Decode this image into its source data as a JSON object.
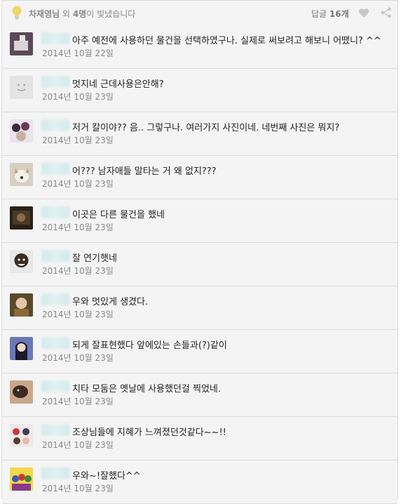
{
  "header": {
    "likes_name": "차재영님",
    "likes_mid": " 외 ",
    "likes_count": "4명",
    "likes_suffix": "이 빛냈습니다",
    "reply_label": "답글 ",
    "reply_count": "16개",
    "icons": [
      "lightbulb-icon",
      "heart-icon",
      "share-icon"
    ]
  },
  "comments": [
    {
      "text": "아주 예전에 사용하던 물건을 선택하였구나. 실제로 써보려고 해보니 어땠니? ^^",
      "date": "2014년 10월 22일",
      "avatar": "photo"
    },
    {
      "text": "멋지네 근데사용은안해?",
      "date": "2014년 10월 23일",
      "avatar": "default"
    },
    {
      "text": "저거 칼이야?? 음.. 그렇구나. 여러가지 사진이네. 네번째 사진은 뭐지?",
      "date": "2014년 10월 23일",
      "avatar": "photo"
    },
    {
      "text": "어??? 남자애들 말타는 거 왜 없지???",
      "date": "2014년 10월 23일",
      "avatar": "photo"
    },
    {
      "text": "이곳은 다른 물건을 했네",
      "date": "2014년 10월 23일",
      "avatar": "photo"
    },
    {
      "text": "잘 연기햇네",
      "date": "2014년 10월 23일",
      "avatar": "photo"
    },
    {
      "text": "우와 멋있게 생겼다.",
      "date": "2014년 10월 23일",
      "avatar": "photo"
    },
    {
      "text": "되게 잘표현했다 앞에있는 손들과(?)같이",
      "date": "2014년 10월 23일",
      "avatar": "photo"
    },
    {
      "text": "치타 모둠은 옛날에 사용했던걸 찍었네.",
      "date": "2014년 10월 23일",
      "avatar": "photo"
    },
    {
      "text": "조상님들에 지혜가 느껴졌던것같다~~!!",
      "date": "2014년 10월 23일",
      "avatar": "photo"
    },
    {
      "text": "우와~!잘했다^^",
      "date": "2014년 10월 23일",
      "avatar": "photo"
    }
  ]
}
